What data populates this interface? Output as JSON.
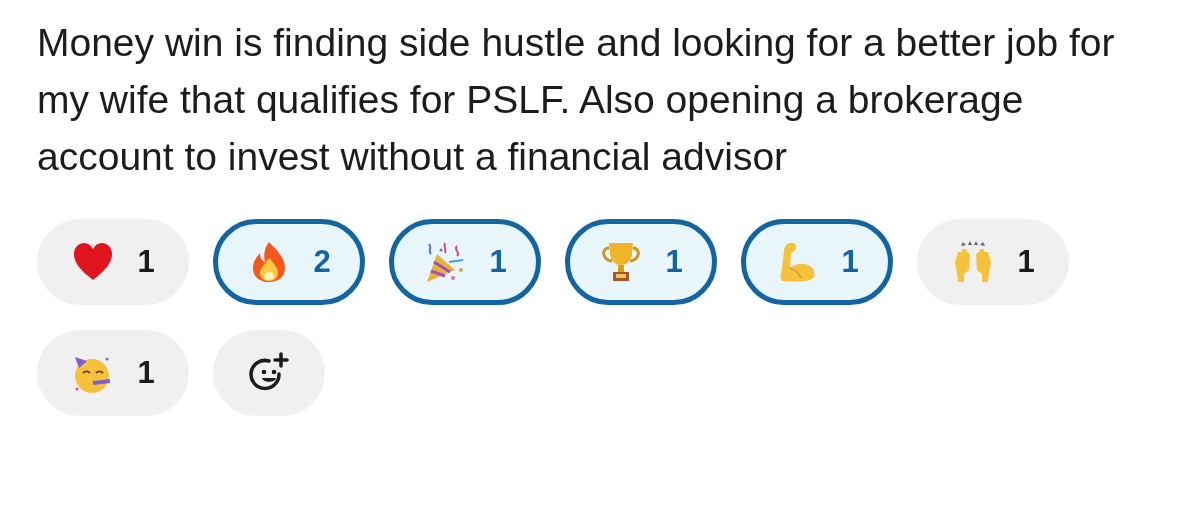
{
  "message": {
    "text": "Money win is finding side hustle and looking for a better job for my wife that qualifies for PSLF. Also opening a brokerage account to invest without a financial advisor"
  },
  "reactions": [
    {
      "kind": "heart",
      "count": "1",
      "selected": false
    },
    {
      "kind": "fire",
      "count": "2",
      "selected": true
    },
    {
      "kind": "party-popper",
      "count": "1",
      "selected": true
    },
    {
      "kind": "trophy",
      "count": "1",
      "selected": true
    },
    {
      "kind": "biceps",
      "count": "1",
      "selected": true
    },
    {
      "kind": "raised-hands",
      "count": "1",
      "selected": false
    },
    {
      "kind": "party-face",
      "count": "1",
      "selected": false
    }
  ],
  "add_reaction": {
    "kind": "add-reaction"
  }
}
